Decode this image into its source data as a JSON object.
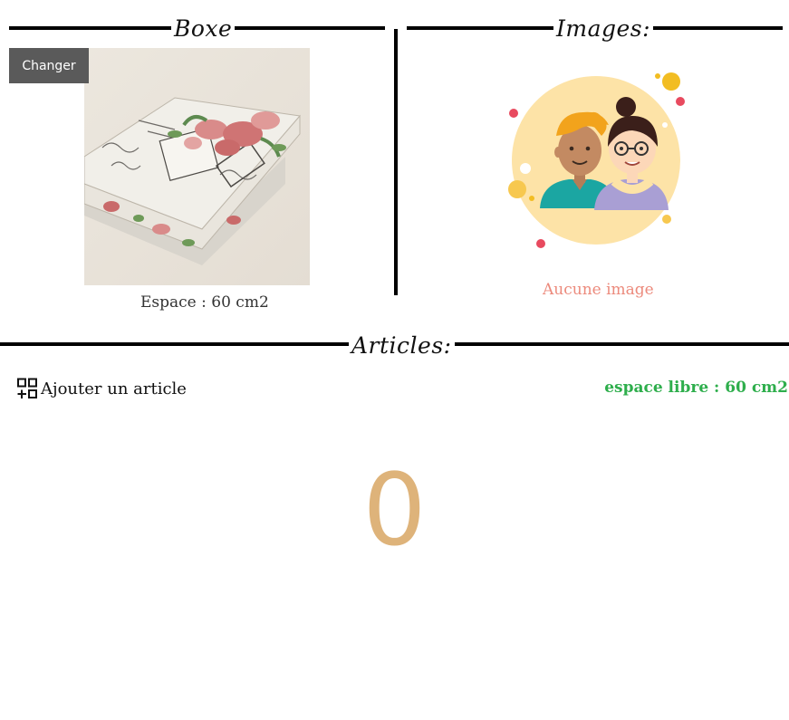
{
  "boxe": {
    "heading": "Boxe",
    "change_button": "Changer",
    "space_label": "Espace : 60 cm2"
  },
  "images": {
    "heading": "Images:",
    "empty_text": "Aucune image"
  },
  "articles": {
    "heading": "Articles:",
    "add_label": "Ajouter un article",
    "free_space": "espace libre : 60 cm2",
    "count": "0"
  },
  "colors": {
    "accent_count": "#deb37a",
    "free_space": "#2eae4c",
    "empty_text": "#ec8a7c",
    "button_bg": "#5a5a5a"
  },
  "icons": {
    "add": "add-grid-icon",
    "placeholder": "users-avatar-icon"
  }
}
